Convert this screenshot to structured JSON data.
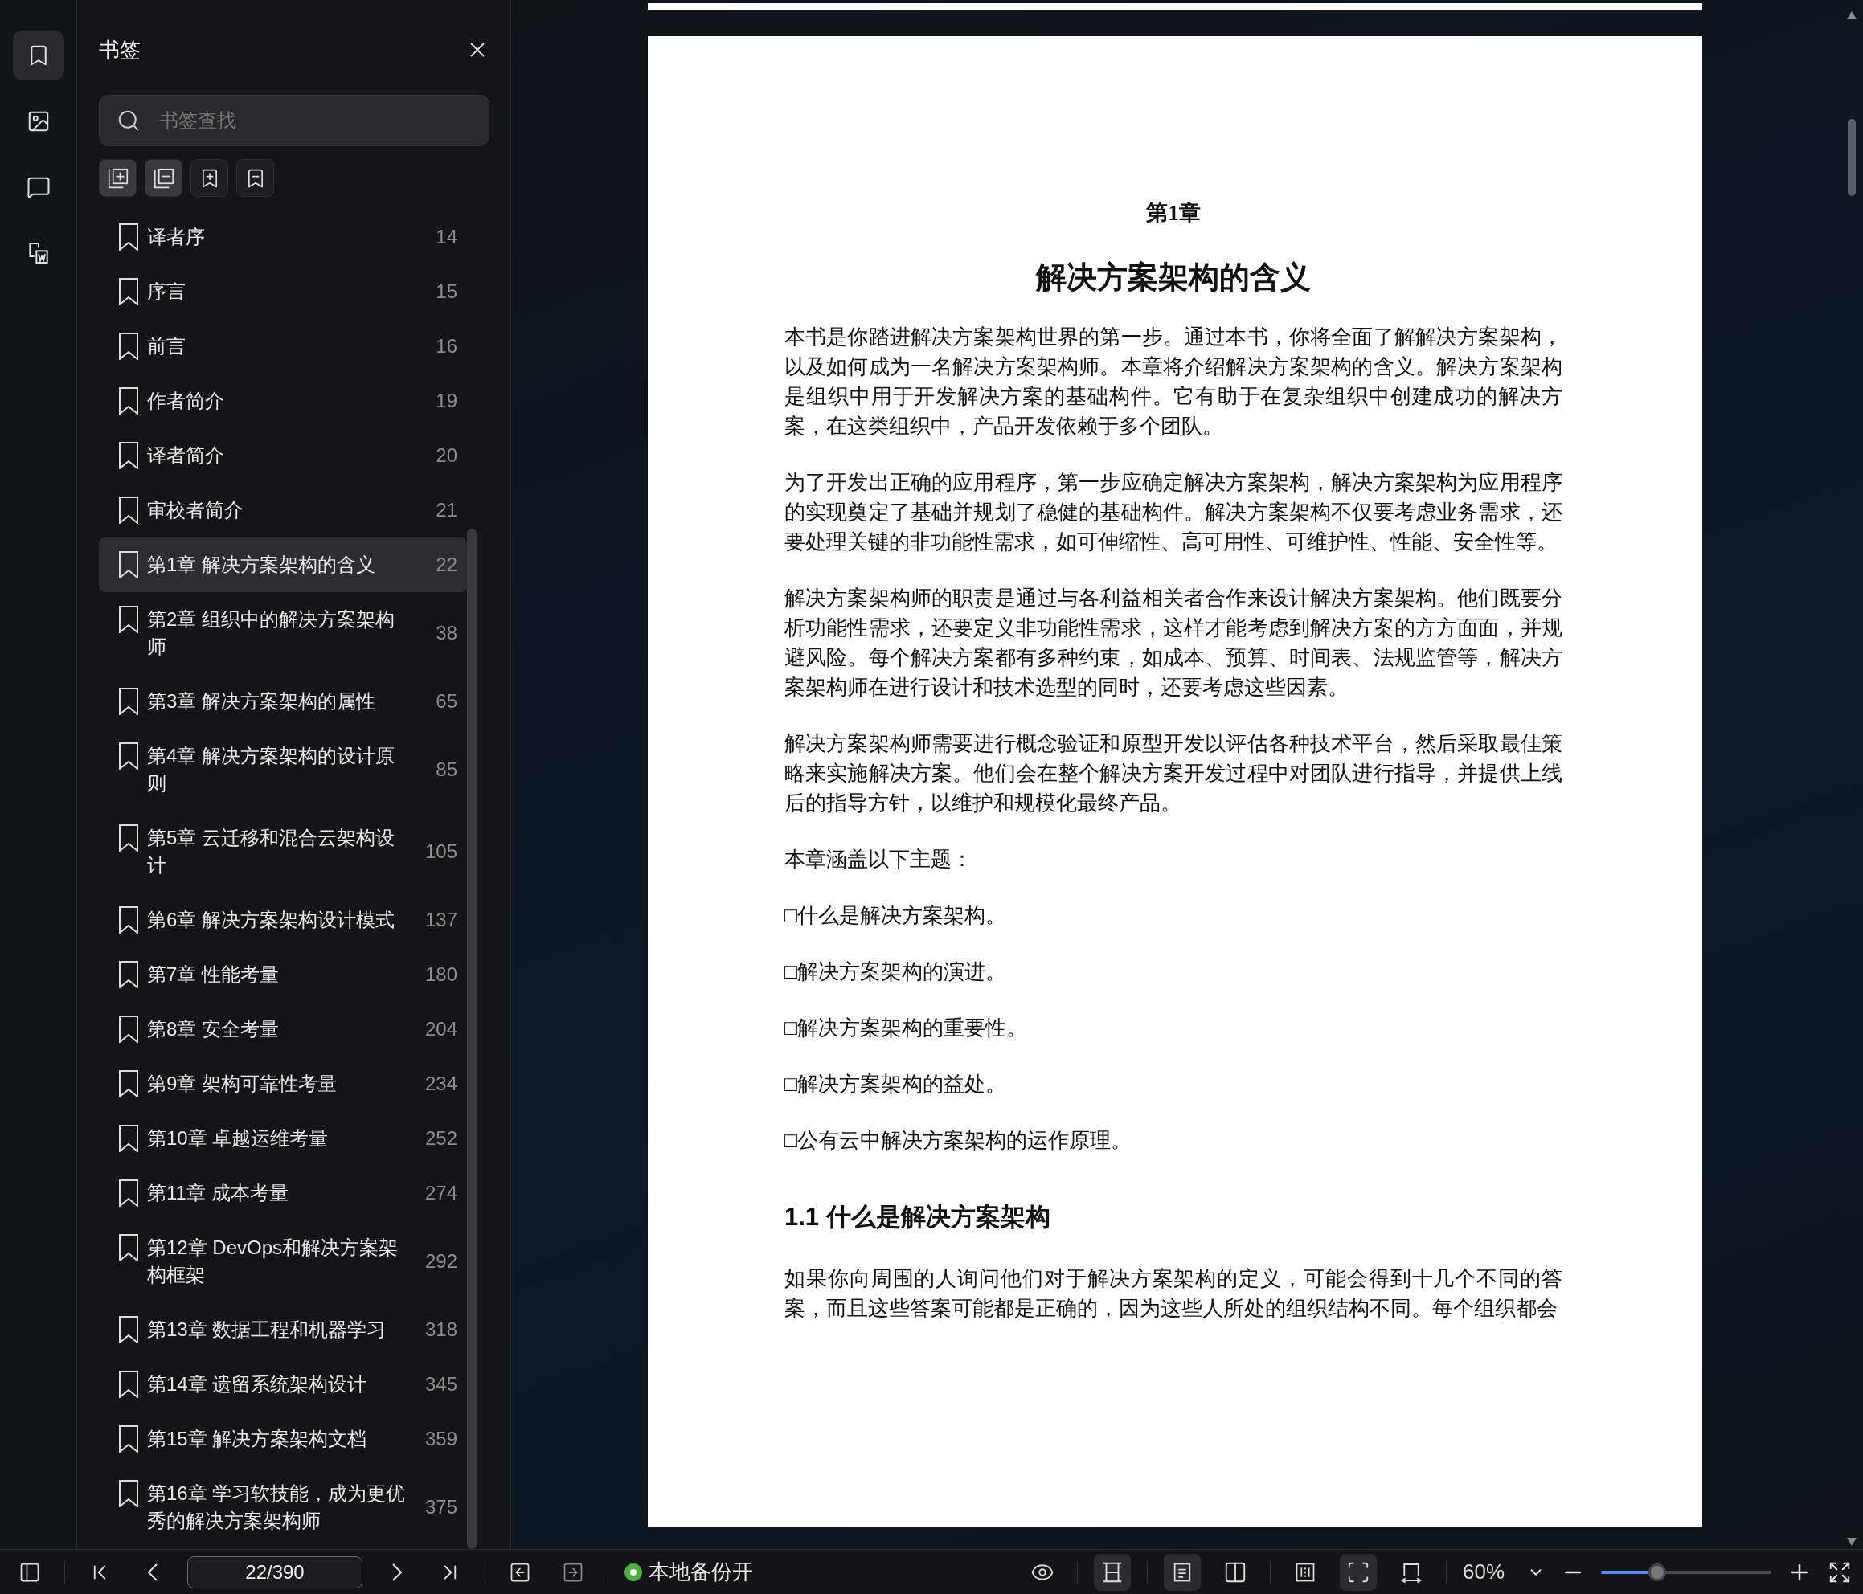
{
  "rail": [
    {
      "kind": "bookmark",
      "selected": true
    },
    {
      "kind": "image",
      "selected": false
    },
    {
      "kind": "comment",
      "selected": false
    },
    {
      "kind": "extract",
      "selected": false
    }
  ],
  "sidebar": {
    "title": "书签",
    "search": {
      "placeholder": "书签查找"
    },
    "tools": [
      {
        "kind": "expand_all",
        "active": true
      },
      {
        "kind": "collapse_all",
        "active": true
      },
      {
        "kind": "add_bookmark",
        "active": false
      },
      {
        "kind": "remove_bookmark",
        "active": false
      }
    ],
    "bookmarks": [
      {
        "label": "译者序",
        "page": "14",
        "selected": false
      },
      {
        "label": "序言",
        "page": "15",
        "selected": false
      },
      {
        "label": "前言",
        "page": "16",
        "selected": false
      },
      {
        "label": "作者简介",
        "page": "19",
        "selected": false
      },
      {
        "label": "译者简介",
        "page": "20",
        "selected": false
      },
      {
        "label": "审校者简介",
        "page": "21",
        "selected": false
      },
      {
        "label": "第1章 解决方案架构的含义",
        "page": "22",
        "selected": true
      },
      {
        "label": "第2章 组织中的解决方案架构师",
        "page": "38",
        "selected": false
      },
      {
        "label": "第3章 解决方案架构的属性",
        "page": "65",
        "selected": false
      },
      {
        "label": "第4章 解决方案架构的设计原则",
        "page": "85",
        "selected": false
      },
      {
        "label": "第5章 云迁移和混合云架构设计",
        "page": "105",
        "selected": false
      },
      {
        "label": "第6章 解决方案架构设计模式",
        "page": "137",
        "selected": false
      },
      {
        "label": "第7章 性能考量",
        "page": "180",
        "selected": false
      },
      {
        "label": "第8章 安全考量",
        "page": "204",
        "selected": false
      },
      {
        "label": "第9章 架构可靠性考量",
        "page": "234",
        "selected": false
      },
      {
        "label": "第10章 卓越运维考量",
        "page": "252",
        "selected": false
      },
      {
        "label": "第11章 成本考量",
        "page": "274",
        "selected": false
      },
      {
        "label": "第12章 DevOps和解决方案架构框架",
        "page": "292",
        "selected": false
      },
      {
        "label": "第13章 数据工程和机器学习",
        "page": "318",
        "selected": false
      },
      {
        "label": "第14章 遗留系统架构设计",
        "page": "345",
        "selected": false
      },
      {
        "label": "第15章 解决方案架构文档",
        "page": "359",
        "selected": false
      },
      {
        "label": "第16章 学习软技能，成为更优秀的解决方案架构师",
        "page": "375",
        "selected": false
      }
    ]
  },
  "document": {
    "chapter_label": "第1章",
    "title": "解决方案架构的含义",
    "paragraphs": [
      "本书是你踏进解决方案架构世界的第一步。通过本书，你将全面了解解决方案架构，以及如何成为一名解决方案架构师。本章将介绍解决方案架构的含义。解决方案架构是组织中用于开发解决方案的基础构件。它有助于在复杂组织中创建成功的解决方案，在这类组织中，产品开发依赖于多个团队。",
      "为了开发出正确的应用程序，第一步应确定解决方案架构，解决方案架构为应用程序的实现奠定了基础并规划了稳健的基础构件。解决方案架构不仅要考虑业务需求，还要处理关键的非功能性需求，如可伸缩性、高可用性、可维护性、性能、安全性等。",
      "解决方案架构师的职责是通过与各利益相关者合作来设计解决方案架构。他们既要分析功能性需求，还要定义非功能性需求，这样才能考虑到解决方案的方方面面，并规避风险。每个解决方案都有多种约束，如成本、预算、时间表、法规监管等，解决方案架构师在进行设计和技术选型的同时，还要考虑这些因素。",
      "解决方案架构师需要进行概念验证和原型开发以评估各种技术平台，然后采取最佳策略来实施解决方案。他们会在整个解决方案开发过程中对团队进行指导，并提供上线后的指导方针，以维护和规模化最终产品。"
    ],
    "topics_intro": "本章涵盖以下主题：",
    "topics": [
      "□什么是解决方案架构。",
      "□解决方案架构的演进。",
      "□解决方案架构的重要性。",
      "□解决方案架构的益处。",
      "□公有云中解决方案架构的运作原理。"
    ],
    "section_heading": "1.1 什么是解决方案架构",
    "section_paragraph": "如果你向周围的人询问他们对于解决方案架构的定义，可能会得到十几个不同的答案，而且这些答案可能都是正确的，因为这些人所处的组织结构不同。每个组织都会"
  },
  "status_bar": {
    "page_field": "22/390",
    "backup": {
      "label": "本地备份开",
      "on": true
    },
    "view_groups": [
      [
        {
          "kind": "fit_height",
          "selected": true
        }
      ],
      [
        {
          "kind": "single",
          "selected": true
        },
        {
          "kind": "double",
          "selected": false
        }
      ],
      [
        {
          "kind": "center",
          "selected": false
        },
        {
          "kind": "fit_page",
          "selected": true
        },
        {
          "kind": "rotate",
          "selected": false
        }
      ]
    ],
    "zoom": {
      "value": "60%",
      "level": 0.33
    }
  }
}
